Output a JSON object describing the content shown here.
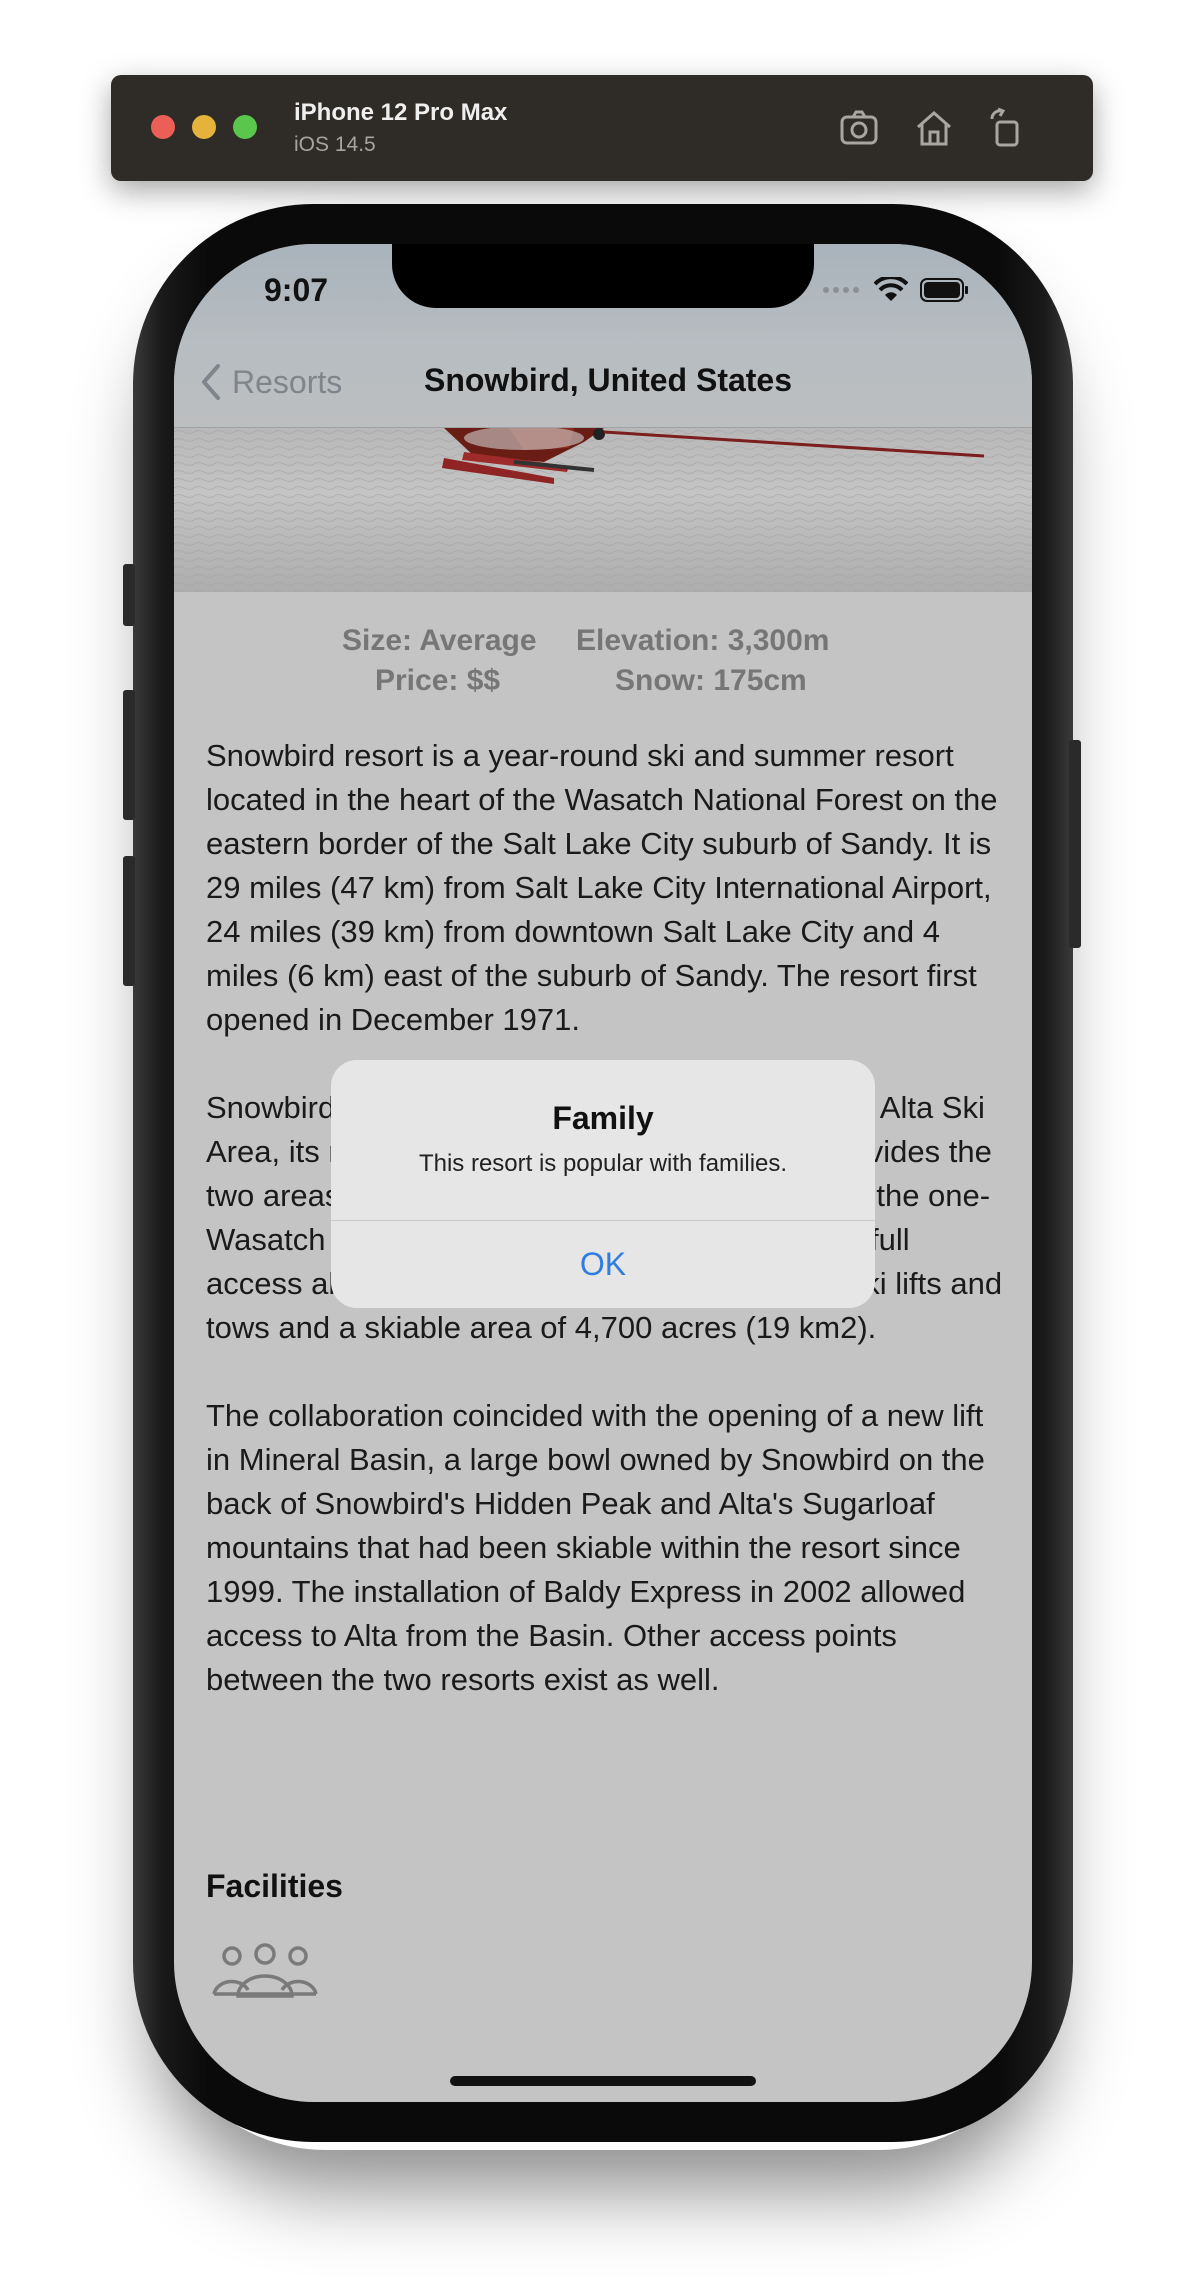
{
  "simulator": {
    "device_name": "iPhone 12 Pro Max",
    "os_version": "iOS 14.5",
    "buttons": [
      "screenshot-icon",
      "home-icon",
      "rotate-icon"
    ]
  },
  "status_bar": {
    "time": "9:07"
  },
  "nav": {
    "back_label": "Resorts",
    "title": "Snowbird, United States"
  },
  "stats": {
    "size": "Size: Average",
    "elevation": "Elevation: 3,300m",
    "price": "Price: $$",
    "snow": "Snow: 175cm"
  },
  "description": {
    "p1": "Snowbird resort is a year-round ski and summer resort located in the heart of the Wasatch National Forest on the eastern border of the Salt Lake City suburb of Sandy. It is 29 miles (47 km) from Salt Lake City International Airport, 24 miles (39 km) from downtown Salt Lake City and 4 miles (6 km) east of the suburb of Sandy. The resort first opened in December 1971.",
    "p2": "Snowbird shares an interconnected ski area with Alta Ski Area, its neighbor to the east over a ridge that divides the two areas. In the winter of 2002, they introduced the one-Wasatch pass and a joint season ticket allowing full access all of the terrain on both mountains: 26 ski lifts and tows and a skiable area of 4,700 acres (19 km2).",
    "p3": "The collaboration coincided with the opening of a new lift in Mineral Basin, a large bowl owned by Snowbird on the back of Snowbird's Hidden Peak and Alta's Sugarloaf mountains that had been skiable within the resort since 1999. The installation of Baldy Express in 2002 allowed access to Alta from the Basin. Other access points between the two resorts exist as well."
  },
  "facilities": {
    "heading": "Facilities",
    "items": [
      {
        "icon": "family-icon"
      }
    ]
  },
  "alert": {
    "title": "Family",
    "message": "This resort is popular with families.",
    "ok_label": "OK"
  },
  "colors": {
    "accent": "#2f7de1",
    "dim_overlay_bg": "#c4c4c4"
  }
}
